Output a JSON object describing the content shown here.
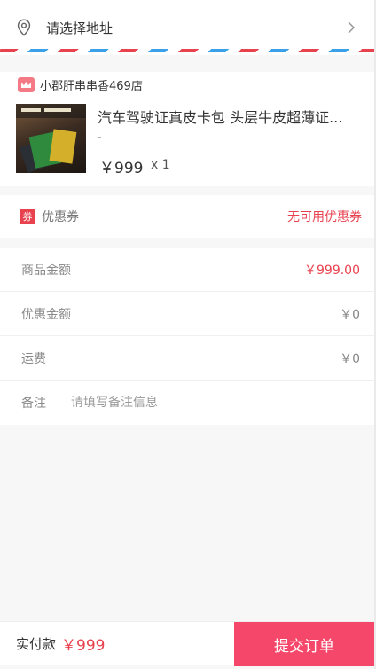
{
  "address": {
    "icon": "location-pin-icon",
    "placeholder_text": "请选择地址",
    "chevron_icon": "chevron-right-icon"
  },
  "shop": {
    "icon": "shop-icon",
    "name": "小郡肝串串香469店"
  },
  "product": {
    "title": "汽车驾驶证真皮卡包 头层牛皮超薄证...",
    "spec": "-",
    "price": "￥999",
    "quantity": "x 1"
  },
  "coupon": {
    "tag": "券",
    "label": "优惠券",
    "value": "无可用优惠券"
  },
  "summary": {
    "goods_amount_label": "商品金额",
    "goods_amount_value": "￥999.00",
    "discount_label": "优惠金额",
    "discount_value": "￥0",
    "shipping_label": "运费",
    "shipping_value": "￥0",
    "note_label": "备注",
    "note_placeholder": "请填写备注信息"
  },
  "footer": {
    "pay_label": "实付款",
    "pay_amount": "￥999",
    "submit_label": "提交订单"
  },
  "colors": {
    "accent": "#f5476a",
    "price_red": "#e8424f",
    "stripe_blue": "#3aa0e8"
  }
}
